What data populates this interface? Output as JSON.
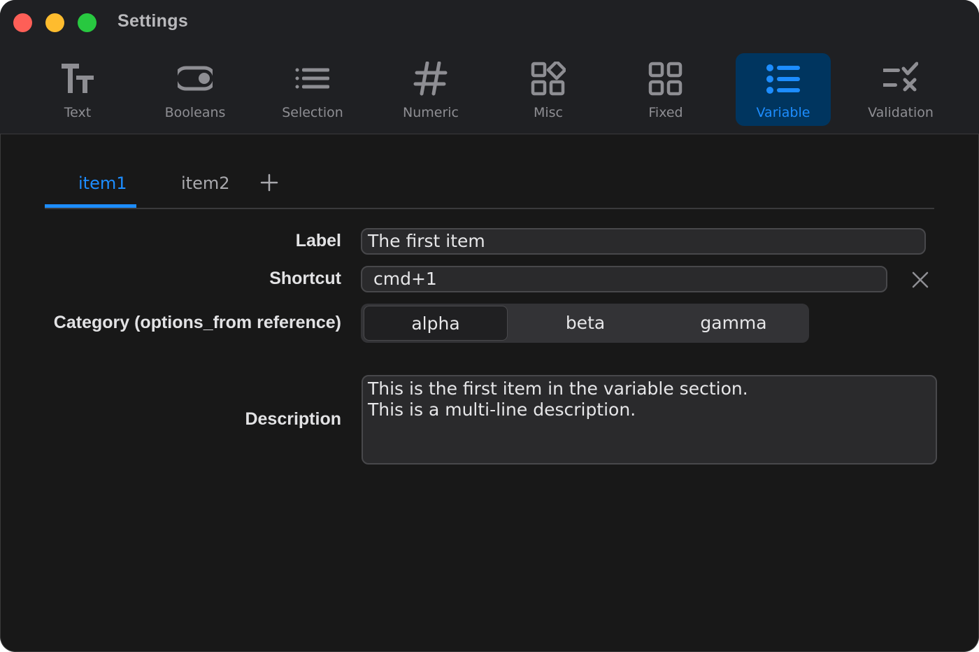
{
  "window": {
    "title": "Settings"
  },
  "toolbar": {
    "items": [
      {
        "label": "Text",
        "icon": "text-size-icon"
      },
      {
        "label": "Booleans",
        "icon": "toggle-icon"
      },
      {
        "label": "Selection",
        "icon": "list-icon"
      },
      {
        "label": "Numeric",
        "icon": "number-sign-icon"
      },
      {
        "label": "Misc",
        "icon": "misc-shapes-icon"
      },
      {
        "label": "Fixed",
        "icon": "grid-icon"
      },
      {
        "label": "Variable",
        "icon": "bulleted-list-icon",
        "active": true
      },
      {
        "label": "Validation",
        "icon": "validation-check-icon"
      }
    ]
  },
  "tabs": {
    "items": [
      {
        "label": "item1",
        "active": true
      },
      {
        "label": "item2",
        "active": false
      }
    ]
  },
  "form": {
    "label": {
      "label": "Label",
      "value": "The first item"
    },
    "shortcut": {
      "label": "Shortcut",
      "value": "cmd+1"
    },
    "category": {
      "label": "Category (options_from reference)",
      "options": [
        "alpha",
        "beta",
        "gamma"
      ],
      "selected": "alpha"
    },
    "description": {
      "label": "Description",
      "value": "This is the first item in the variable section.\nThis is a multi-line description."
    }
  },
  "colors": {
    "accent": "#1d8dff",
    "active_bg": "#00355f",
    "window_bg": "#181818",
    "toolbar_bg": "#1f2023"
  }
}
